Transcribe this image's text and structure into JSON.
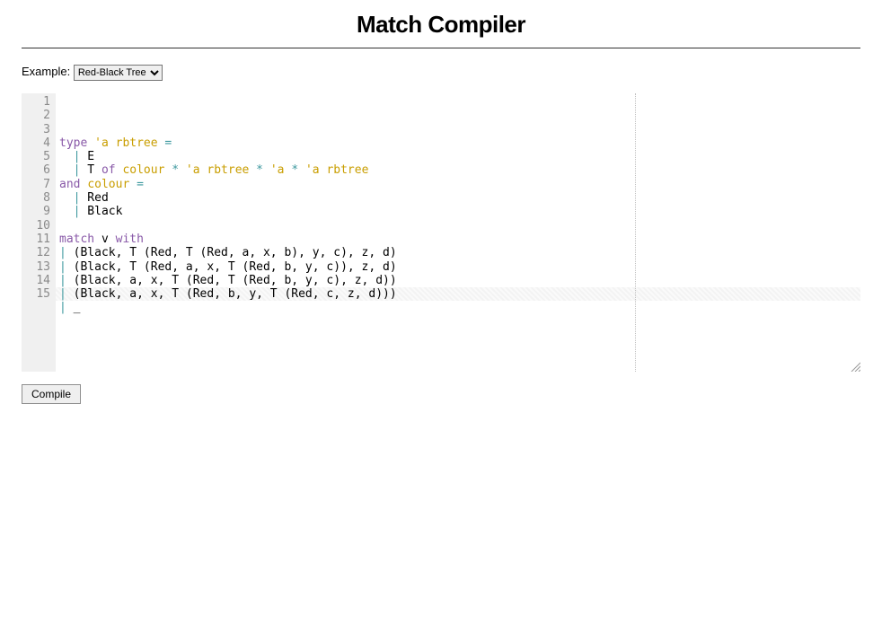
{
  "header": {
    "title": "Match Compiler"
  },
  "example": {
    "label": "Example:",
    "selected": "Red-Black Tree",
    "options": [
      "Red-Black Tree"
    ]
  },
  "editor": {
    "line_count": 15,
    "active_line": 15,
    "lines": [
      [
        [
          "kw",
          "type "
        ],
        [
          "typ",
          "'a rbtree "
        ],
        [
          "op",
          "="
        ]
      ],
      [
        [
          "",
          "  "
        ],
        [
          "op",
          "|"
        ],
        [
          "",
          " E"
        ]
      ],
      [
        [
          "",
          "  "
        ],
        [
          "op",
          "|"
        ],
        [
          "",
          " T "
        ],
        [
          "kw",
          "of "
        ],
        [
          "typ",
          "colour "
        ],
        [
          "op",
          "*"
        ],
        [
          "typ",
          " 'a rbtree "
        ],
        [
          "op",
          "*"
        ],
        [
          "typ",
          " 'a "
        ],
        [
          "op",
          "*"
        ],
        [
          "typ",
          " 'a rbtree"
        ]
      ],
      [
        [
          "kw",
          "and "
        ],
        [
          "typ",
          "colour "
        ],
        [
          "op",
          "="
        ]
      ],
      [
        [
          "",
          "  "
        ],
        [
          "op",
          "|"
        ],
        [
          "",
          " Red"
        ]
      ],
      [
        [
          "",
          "  "
        ],
        [
          "op",
          "|"
        ],
        [
          "",
          " Black"
        ]
      ],
      [
        [
          "",
          ""
        ]
      ],
      [
        [
          "kw",
          "match "
        ],
        [
          "",
          "v "
        ],
        [
          "kw",
          "with"
        ]
      ],
      [
        [
          "op",
          "|"
        ],
        [
          "",
          " (Black, T (Red, T (Red, a, x, b), y, c), z, d)"
        ]
      ],
      [
        [
          "op",
          "|"
        ],
        [
          "",
          " (Black, T (Red, a, x, T (Red, b, y, c)), z, d)"
        ]
      ],
      [
        [
          "op",
          "|"
        ],
        [
          "",
          " (Black, a, x, T (Red, T (Red, b, y, c), z, d))"
        ]
      ],
      [
        [
          "op",
          "|"
        ],
        [
          "",
          " (Black, a, x, T (Red, b, y, T (Red, c, z, d)))"
        ]
      ],
      [
        [
          "op",
          "|"
        ],
        [
          "",
          " _"
        ]
      ],
      [
        [
          "",
          ""
        ]
      ],
      [
        [
          "",
          ""
        ]
      ]
    ]
  },
  "actions": {
    "compile_label": "Compile"
  }
}
